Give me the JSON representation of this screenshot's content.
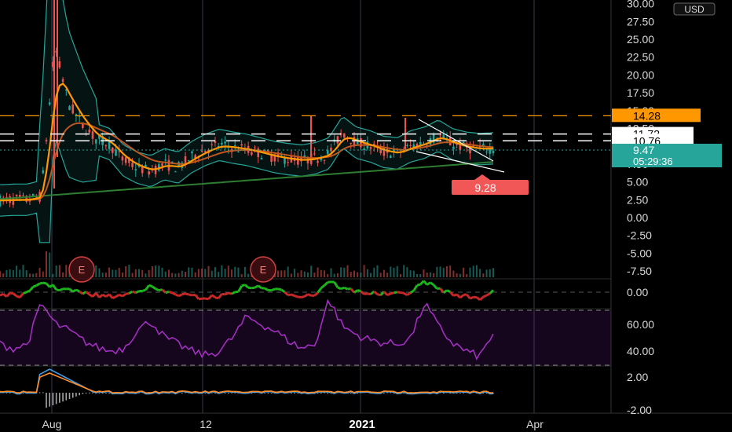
{
  "currency": "USD",
  "price_labels": {
    "upper": "14.28",
    "mid_high": "11.72",
    "mid_low": "10.76",
    "last": "9.47",
    "countdown": "05:29:36",
    "low_marker": "9.28"
  },
  "event_markers": [
    "E",
    "E"
  ],
  "colors": {
    "orange": "#ff9800",
    "teal": "#26a69a",
    "red": "#ef5350",
    "green": "#1db31d",
    "purple": "#a830c8",
    "band": "#26a69a",
    "macd_blue": "#3f9fe8",
    "macd_orange": "#ff8c28"
  },
  "chart_data": [
    {
      "type": "line",
      "name": "price",
      "y_ticks": [
        "30.00",
        "27.50",
        "25.00",
        "22.50",
        "20.00",
        "17.50",
        "15.00",
        "12.50",
        "10.00",
        "7.50",
        "5.00",
        "2.50",
        "0.00",
        "-2.50",
        "-5.00",
        "-7.50"
      ],
      "ylim": [
        -8,
        31
      ],
      "x_ticks": [
        "Aug",
        "12",
        "2021",
        "Apr"
      ],
      "close_values": [
        2.4,
        2.5,
        2.5,
        3.0,
        24.0,
        16.0,
        13.0,
        11.0,
        10.3,
        8.0,
        7.0,
        6.5,
        7.5,
        7.0,
        8.5,
        9.5,
        10.2,
        9.8,
        9.5,
        9.0,
        8.5,
        8.2,
        8.0,
        8.3,
        9.0,
        12.0,
        10.5,
        10.0,
        9.2,
        9.0,
        10.0,
        10.5,
        11.5,
        10.3,
        9.8,
        9.6,
        9.7
      ],
      "levels": [
        14.28,
        11.72,
        10.76
      ],
      "last_price": 9.47,
      "low_marker": 9.28
    },
    {
      "type": "line",
      "name": "momentum-oscillator",
      "y_ticks": [
        "0.00"
      ]
    },
    {
      "type": "line",
      "name": "rsi",
      "y_ticks": [
        "60.00",
        "40.00"
      ],
      "values": [
        45,
        42,
        45,
        75,
        60,
        55,
        48,
        43,
        40,
        42,
        55,
        62,
        50,
        45,
        40,
        37,
        40,
        50,
        65,
        60,
        55,
        48,
        42,
        45,
        78,
        58,
        52,
        48,
        46,
        45,
        50,
        75,
        58,
        46,
        40,
        36,
        53
      ]
    },
    {
      "type": "bar",
      "name": "macd",
      "y_ticks": [
        "2.00",
        "-2.00"
      ]
    }
  ]
}
